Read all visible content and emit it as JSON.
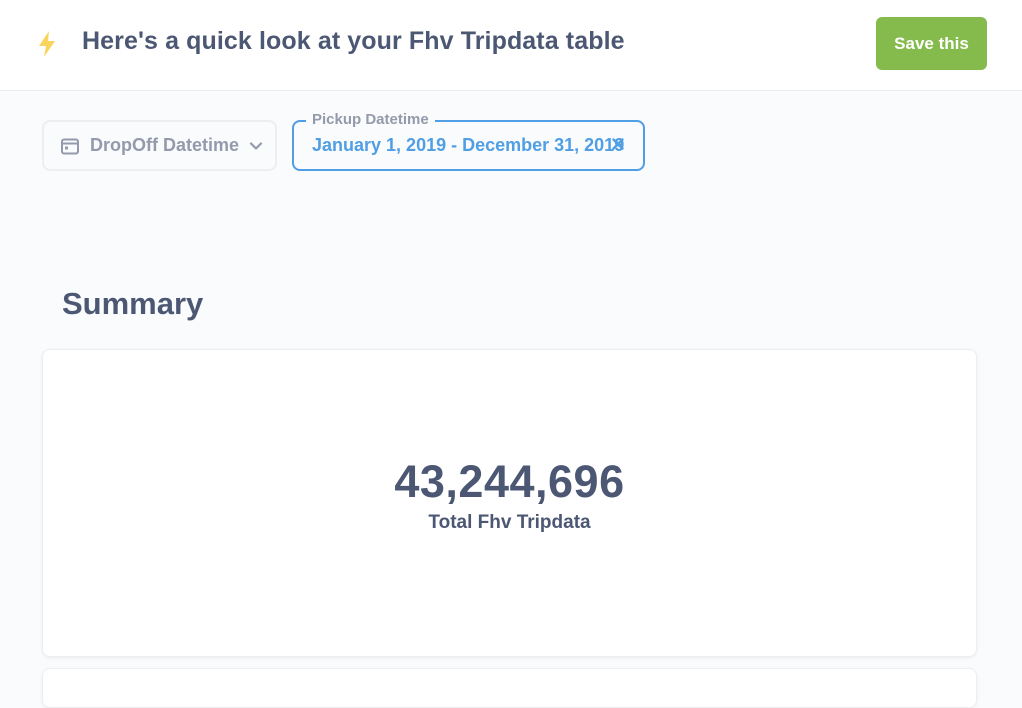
{
  "header": {
    "icon": "bolt-icon",
    "icon_color": "#f9d45c",
    "title": "Here's a quick look at your Fhv Tripdata table",
    "save_label": "Save this",
    "save_color": "#84bb4c"
  },
  "filters": {
    "dropoff": {
      "icon": "calendar-icon",
      "label": "DropOff Datetime",
      "chevron": "chevron-down-icon"
    },
    "pickup": {
      "legend": "Pickup Datetime",
      "value": "January 1, 2019 - December 31, 2019",
      "clear_icon": "close-icon",
      "accent": "#509ee3"
    }
  },
  "summary": {
    "title": "Summary",
    "metric_value": "43,244,696",
    "metric_label": "Total Fhv Tripdata"
  }
}
